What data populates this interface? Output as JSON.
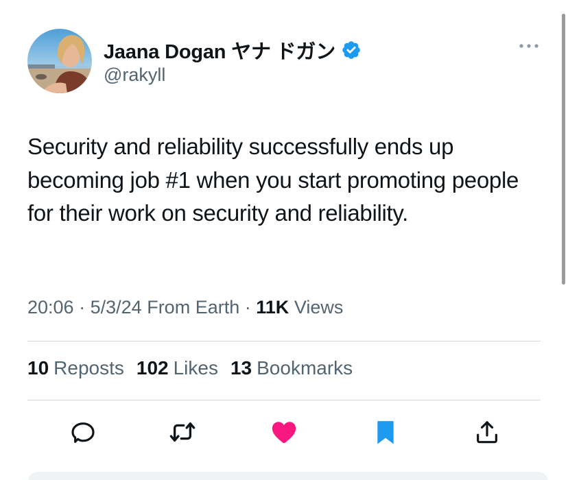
{
  "author": {
    "display_name": "Jaana Dogan ヤナ ドガン",
    "handle": "@rakyll",
    "verified": true,
    "avatar": "profile-photo"
  },
  "tweet": {
    "text": "Security and reliability successfully ends up becoming job #1 when you start promoting people for their work on security and reliability.",
    "time": "20:06",
    "separator": "·",
    "date": "5/3/24",
    "source": "From Earth",
    "views_count": "11K",
    "views_label": "Views"
  },
  "stats": {
    "reposts": {
      "count": "10",
      "label": "Reposts"
    },
    "likes": {
      "count": "102",
      "label": "Likes"
    },
    "bookmarks": {
      "count": "13",
      "label": "Bookmarks"
    }
  },
  "actions": [
    "reply-icon",
    "repost-icon",
    "like-icon",
    "bookmark-icon",
    "share-icon"
  ],
  "colors": {
    "text": "#0f1419",
    "secondary": "#536471",
    "verified": "#1d9bf0",
    "like_active": "#f91880",
    "bookmark_active": "#1d9bf0",
    "divider": "#cfd9de"
  }
}
